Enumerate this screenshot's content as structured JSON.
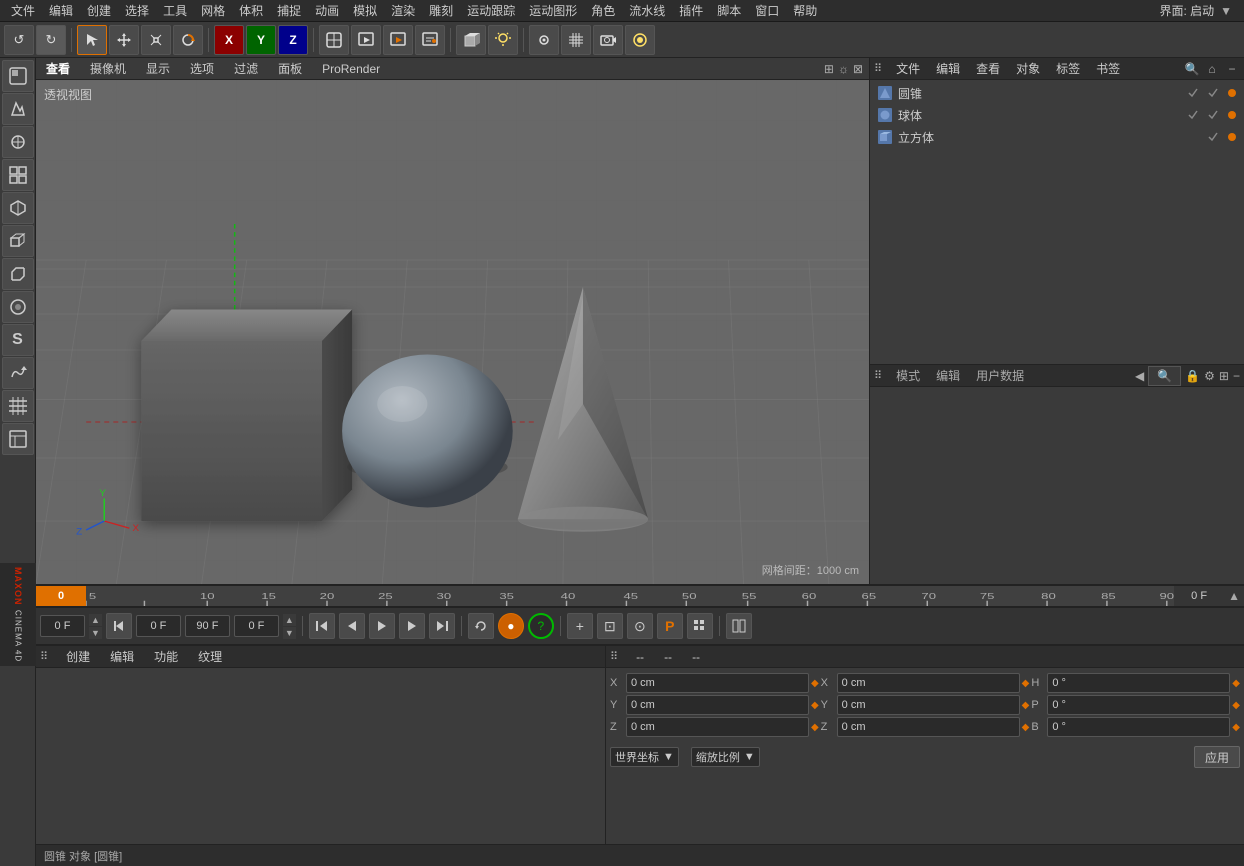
{
  "app": {
    "title": "Cinema 4D",
    "top_right": "界面: 启动"
  },
  "top_menu": {
    "items": [
      "文件",
      "编辑",
      "创建",
      "选择",
      "工具",
      "网格",
      "体积",
      "捕捉",
      "动画",
      "模拟",
      "渲染",
      "雕刻",
      "运动跟踪",
      "运动图形",
      "角色",
      "流水线",
      "插件",
      "脚本",
      "窗口",
      "帮助"
    ]
  },
  "toolbar": {
    "undo_icon": "↺",
    "redo_icon": "↻",
    "move_icon": "↖",
    "scale_icon": "+",
    "rotate_icon": "○",
    "x_axis": "X",
    "y_axis": "Y",
    "z_axis": "Z",
    "render_icon": "▶"
  },
  "viewport": {
    "tabs": [
      "查看",
      "摄像机",
      "显示",
      "选项",
      "过滤",
      "面板",
      "ProRender"
    ],
    "label": "透视视图",
    "grid_info": "网格间距：1000 cm"
  },
  "right_panel": {
    "top_tabs": [
      "文件",
      "编辑",
      "查看",
      "对象",
      "标签",
      "书签"
    ],
    "objects": [
      {
        "name": "圆锥",
        "color": "#e07000",
        "checks": "✓✓"
      },
      {
        "name": "球体",
        "color": "#e07000",
        "checks": "✓✓"
      },
      {
        "name": "立方体",
        "color": "#e07000",
        "checks": "✓"
      }
    ],
    "bottom_tabs": [
      "模式",
      "编辑",
      "用户数据"
    ]
  },
  "timeline": {
    "start": "0",
    "end": "0 F",
    "frame_field1": "0 F",
    "frame_field2": "90 F",
    "frame_field3": "0 F",
    "ticks": [
      "0",
      "5",
      "10",
      "15",
      "20",
      "25",
      "30",
      "35",
      "40",
      "45",
      "50",
      "55",
      "60",
      "65",
      "70",
      "75",
      "80",
      "85",
      "90"
    ]
  },
  "transport": {
    "play": "▶",
    "stop": "■",
    "prev": "◀◀",
    "next": "▶▶",
    "record": "●",
    "loop": "⟳"
  },
  "bottom_left": {
    "tabs": [
      "创建",
      "编辑",
      "功能",
      "纹理"
    ]
  },
  "bottom_right": {
    "tabs": [
      "--",
      "--",
      "--"
    ],
    "coords": {
      "x_pos": "0 cm",
      "y_pos": "0 cm",
      "z_pos": "0 cm",
      "x_rot": "0 cm",
      "y_rot": "0 cm",
      "z_rot": "0 cm",
      "h": "0 °",
      "p": "0 °",
      "b": "0 °"
    },
    "mode_label": "世界坐标",
    "scale_label": "缩放比例",
    "apply_label": "应用"
  },
  "status_bar": {
    "text": "圆锥 对象 [圆锥]"
  },
  "colors": {
    "accent": "#e07000",
    "bg_dark": "#2d2d2d",
    "bg_mid": "#3a3a3a",
    "bg_light": "#4a4a4a",
    "grid": "#686868",
    "axis_x": "#cc0000",
    "axis_y": "#00bb00",
    "axis_z": "#0055cc"
  }
}
